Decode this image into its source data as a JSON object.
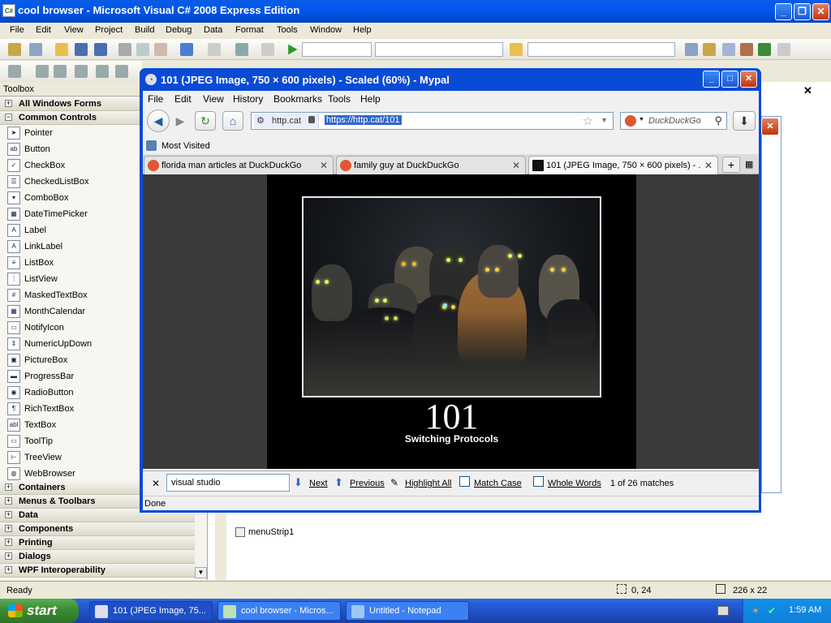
{
  "vs": {
    "icon_text": "C#",
    "title": "cool browser - Microsoft Visual C# 2008 Express Edition",
    "menu": [
      "File",
      "Edit",
      "View",
      "Project",
      "Build",
      "Debug",
      "Data",
      "Format",
      "Tools",
      "Window",
      "Help"
    ],
    "toolbox_title": "Toolbox",
    "toolbox_categories_top": [
      "All Windows Forms",
      "Common Controls"
    ],
    "toolbox_items": [
      {
        "label": "Pointer",
        "icon": "pointer-icon"
      },
      {
        "label": "Button",
        "icon": "button-icon"
      },
      {
        "label": "CheckBox",
        "icon": "checkbox-icon"
      },
      {
        "label": "CheckedListBox",
        "icon": "checkedlistbox-icon"
      },
      {
        "label": "ComboBox",
        "icon": "combobox-icon"
      },
      {
        "label": "DateTimePicker",
        "icon": "datetimepicker-icon"
      },
      {
        "label": "Label",
        "icon": "label-icon"
      },
      {
        "label": "LinkLabel",
        "icon": "linklabel-icon"
      },
      {
        "label": "ListBox",
        "icon": "listbox-icon"
      },
      {
        "label": "ListView",
        "icon": "listview-icon"
      },
      {
        "label": "MaskedTextBox",
        "icon": "maskedtextbox-icon"
      },
      {
        "label": "MonthCalendar",
        "icon": "monthcalendar-icon"
      },
      {
        "label": "NotifyIcon",
        "icon": "notifyicon-icon"
      },
      {
        "label": "NumericUpDown",
        "icon": "numericupdown-icon"
      },
      {
        "label": "PictureBox",
        "icon": "picturebox-icon"
      },
      {
        "label": "ProgressBar",
        "icon": "progressbar-icon"
      },
      {
        "label": "RadioButton",
        "icon": "radiobutton-icon"
      },
      {
        "label": "RichTextBox",
        "icon": "richtextbox-icon"
      },
      {
        "label": "TextBox",
        "icon": "textbox-icon"
      },
      {
        "label": "ToolTip",
        "icon": "tooltip-icon"
      },
      {
        "label": "TreeView",
        "icon": "treeview-icon"
      },
      {
        "label": "WebBrowser",
        "icon": "webbrowser-icon"
      }
    ],
    "toolbox_categories_bottom": [
      "Containers",
      "Menus & Toolbars",
      "Data",
      "Components",
      "Printing",
      "Dialogs",
      "WPF Interoperability"
    ],
    "component_tray_item": "menuStrip1",
    "status": {
      "ready": "Ready",
      "position": "0, 24",
      "size": "226 x 22"
    }
  },
  "browser": {
    "title": "101 (JPEG Image, 750 × 600 pixels) - Scaled (60%) - Mypal",
    "menu": [
      "File",
      "Edit",
      "View",
      "History",
      "Bookmarks",
      "Tools",
      "Help"
    ],
    "site_label": "http.cat",
    "url": "https://http.cat/101",
    "search_placeholder": "DuckDuckGo",
    "bookmarks_label": "Most Visited",
    "tabs": [
      {
        "label": "florida man articles at DuckDuckGo"
      },
      {
        "label": "family guy at DuckDuckGo"
      },
      {
        "label": "101 (JPEG Image, 750 × 600 pixels) - ..."
      }
    ],
    "image_code": "101",
    "image_message": "Switching Protocols",
    "find": {
      "query": "visual studio",
      "next": "Next",
      "previous": "Previous",
      "highlight_all": "Highlight All",
      "match_case": "Match Case",
      "whole_words": "Whole Words",
      "matches": "1 of 26 matches"
    },
    "status": "Done"
  },
  "taskbar": {
    "start": "start",
    "tasks": [
      "101 (JPEG Image, 75...",
      "cool browser - Micros...",
      "Untitled - Notepad"
    ],
    "clock": "1:59 AM"
  },
  "colors": {
    "xp_blue": "#0058ee",
    "start_green": "#3c8f34",
    "selection": "#3366cc"
  }
}
